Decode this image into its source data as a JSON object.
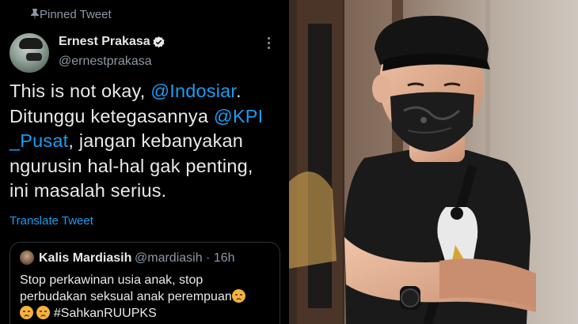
{
  "pinned_label": "Pinned Tweet",
  "author": {
    "name": "Ernest Prakasa",
    "handle": "@ernestprakasa"
  },
  "tweet": {
    "line1_a": "This is not okay, ",
    "line1_mention": "@Indosiar",
    "line1_b": ".",
    "line2_a": "Ditunggu ketegasannya ",
    "line2_mention": "@KPI",
    "line3_mention": "_Pusat",
    "line3_b": ", jangan kebanyakan",
    "line4": "ngurusin hal-hal gak penting,",
    "line5": "ini masalah serius."
  },
  "translate_label": "Translate Tweet",
  "quote": {
    "name": "Kalis Mardiasih",
    "meta": "@mardiasih · 16h",
    "line1": "Stop perkawinan usia anak, stop",
    "line2": "perbudakan seksual anak perempuan",
    "line3": " #SahkanRUUPKS"
  },
  "colors": {
    "background": "#000000",
    "link": "#1d9bf0",
    "secondary_text": "#8b98a5",
    "border": "#2f3336"
  },
  "icons": [
    "pin-icon",
    "verified-badge-icon",
    "more-options-icon",
    "sad-face-emoji-icon"
  ],
  "photo": {
    "subject": "man wearing black cap, black paisley face mask and black graphic t-shirt"
  }
}
